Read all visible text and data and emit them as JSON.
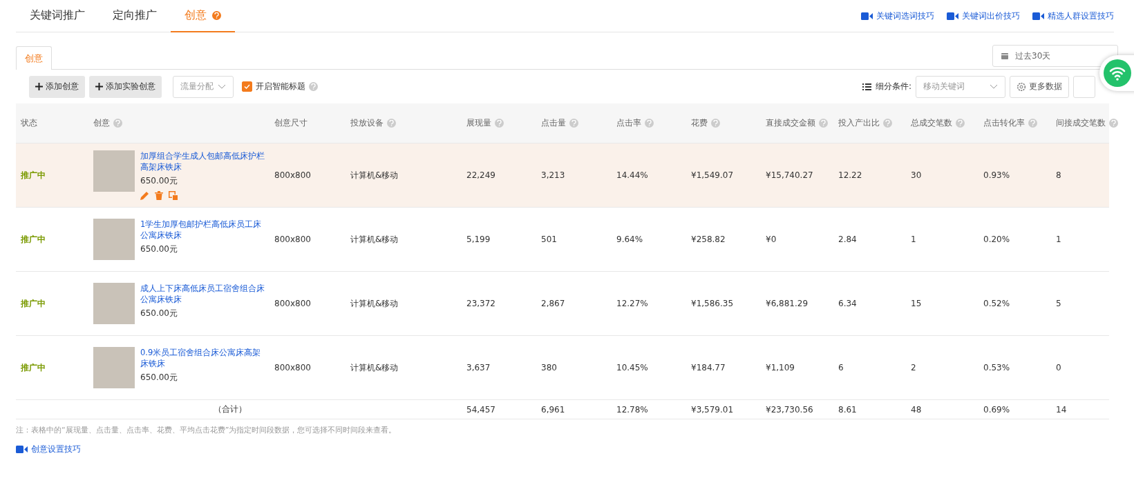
{
  "top_tabs": [
    {
      "label": "关键词推广",
      "selected": false,
      "help": false
    },
    {
      "label": "定向推广",
      "selected": false,
      "help": false
    },
    {
      "label": "创意",
      "selected": true,
      "help": true
    }
  ],
  "tip_links": [
    "关键词选词技巧",
    "关键词出价技巧",
    "精选人群设置技巧"
  ],
  "inner_tabs": [
    {
      "label": "创意",
      "selected": true
    }
  ],
  "date_range": {
    "value": "过去30天"
  },
  "toolbar": {
    "buttons": [
      {
        "label": "添加创意"
      },
      {
        "label": "添加实验创意"
      }
    ],
    "traffic_select": {
      "placeholder": "流量分配"
    },
    "smart_title": {
      "label": "开启智能标题",
      "checked": true
    },
    "segment_label": "细分条件:",
    "segment_select": {
      "placeholder": "移动关键词"
    },
    "more_data": "更多数据"
  },
  "table": {
    "columns": [
      {
        "label": "状态",
        "help": false
      },
      {
        "label": "创意",
        "help": true
      },
      {
        "label": "创意尺寸",
        "help": false
      },
      {
        "label": "投放设备",
        "help": true
      },
      {
        "label": "展现量",
        "help": true
      },
      {
        "label": "点击量",
        "help": true
      },
      {
        "label": "点击率",
        "help": true
      },
      {
        "label": "花费",
        "help": true
      },
      {
        "label": "直接成交金额",
        "help": true
      },
      {
        "label": "投入产出比",
        "help": true
      },
      {
        "label": "总成交笔数",
        "help": true
      },
      {
        "label": "点击转化率",
        "help": true
      },
      {
        "label": "间接成交笔数",
        "help": true
      }
    ],
    "rows": [
      {
        "selected": true,
        "status": "推广中",
        "title": "加厚组合学生成人包邮高低床护栏高架床铁床",
        "price": "650.00元",
        "size": "800x800",
        "device": "计算机&移动",
        "values": [
          "22,249",
          "3,213",
          "14.44%",
          "¥1,549.07",
          "¥15,740.27",
          "12.22",
          "30",
          "0.93%",
          "8"
        ]
      },
      {
        "selected": false,
        "status": "推广中",
        "title": "1学生加厚包邮护栏高低床员工床公寓床铁床",
        "price": "650.00元",
        "size": "800x800",
        "device": "计算机&移动",
        "values": [
          "5,199",
          "501",
          "9.64%",
          "¥258.82",
          "¥0",
          "2.84",
          "1",
          "0.20%",
          "1"
        ]
      },
      {
        "selected": false,
        "status": "推广中",
        "title": "成人上下床高低床员工宿舍组合床公寓床铁床",
        "price": "650.00元",
        "size": "800x800",
        "device": "计算机&移动",
        "values": [
          "23,372",
          "2,867",
          "12.27%",
          "¥1,586.35",
          "¥6,881.29",
          "6.34",
          "15",
          "0.52%",
          "5"
        ]
      },
      {
        "selected": false,
        "status": "推广中",
        "title": "0.9米员工宿舍组合床公寓床高架床铁床",
        "price": "650.00元",
        "size": "800x800",
        "device": "计算机&移动",
        "values": [
          "3,637",
          "380",
          "10.45%",
          "¥184.77",
          "¥1,109",
          "6",
          "2",
          "0.53%",
          "0"
        ]
      }
    ],
    "total": {
      "label": "（合计）",
      "values": [
        "54,457",
        "6,961",
        "12.78%",
        "¥3,579.01",
        "¥23,730.56",
        "8.61",
        "48",
        "0.69%",
        "14"
      ]
    }
  },
  "note": "注：表格中的“展现量、点击量、点击率、花费、平均点击花费”为指定时间段数据，您可选择不同时间段来查看。",
  "bottom_link": "创意设置技巧"
}
